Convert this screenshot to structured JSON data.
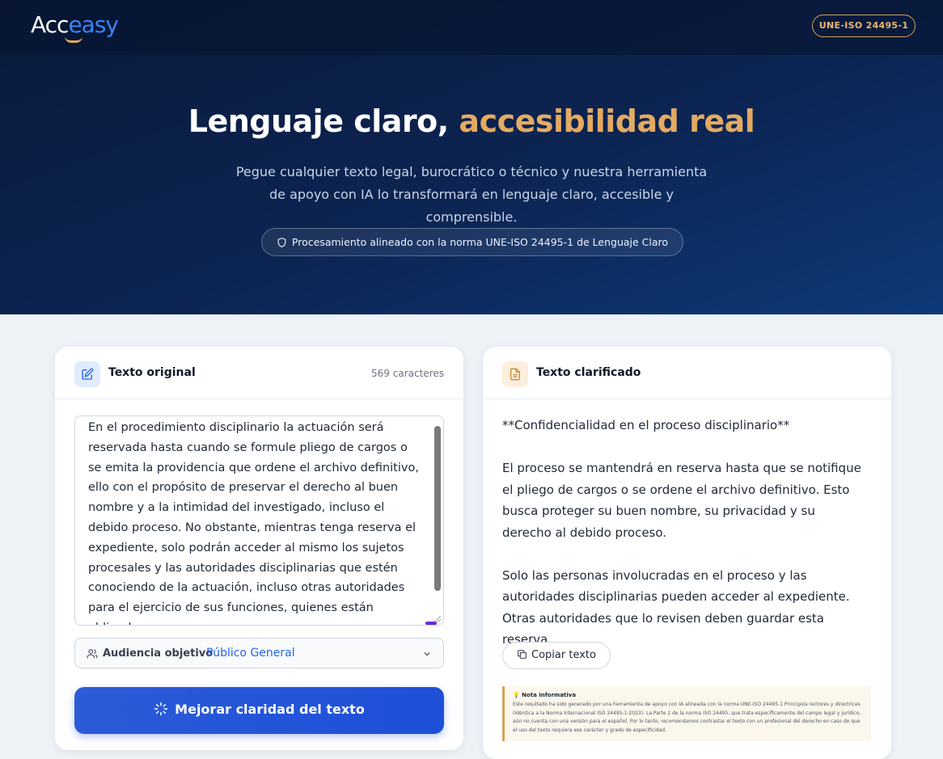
{
  "header": {
    "logo_part1": "Acc",
    "logo_part2": "easy",
    "iso_badge": "UNE-ISO 24495-1"
  },
  "hero": {
    "title_plain": "Lenguaje claro,",
    "title_accent": "accesibilidad real",
    "subtitle": "Pegue cualquier texto legal, burocrático o técnico y nuestra herramienta de apoyo con IA lo transformará en lenguaje claro, accesible y comprensible.",
    "pill": "Procesamiento alineado con la norma UNE-ISO 24495-1 de Lenguaje Claro"
  },
  "original": {
    "title": "Texto original",
    "char_count": "569 caracteres",
    "text": "En el procedimiento disciplinario la actuación será reservada hasta cuando se formule pliego de cargos o se emita la providencia que ordene el archivo definitivo, ello con el propósito de preservar el derecho al buen nombre y a la intimidad del investigado, incluso el debido proceso. No obstante, mientras tenga reserva el expediente, solo podrán acceder al mismo los sujetos procesales y las autoridades disciplinarias que estén conociendo de la actuación, incluso otras autoridades para el ejercicio de sus funciones, quienes están obligados a preservar esa",
    "audience_label": "Audiencia objetivo",
    "audience_value": "Público General",
    "improve_button": "Mejorar claridad del texto"
  },
  "clarified": {
    "title": "Texto clarificado",
    "paragraph1": "**Confidencialidad en el proceso disciplinario**",
    "paragraph2": "El proceso se mantendrá en reserva hasta que se notifique el pliego de cargos o se ordene el archivo definitivo. Esto busca proteger su buen nombre, su privacidad y su derecho al debido proceso.",
    "paragraph3": "Solo las personas involucradas en el proceso y las autoridades disciplinarias pueden acceder al expediente. Otras autoridades que lo revisen deben guardar esta reserva.",
    "copy_button": "Copiar texto",
    "note_title": "Nota informativa",
    "note_body": "Este resultado ha sido generado por una herramienta de apoyo con IA alineada con la norma UNE-ISO 24495-1 Principios rectores y directrices (Idéntica a la Norma Internacional ISO 24495-1:2023). La Parte 2 de la norma ISO 24495, que trata específicamente del campo legal y jurídico, aún no cuenta con una versión para el español. Por lo tanto, recomendamos contrastar el texto con un profesional del derecho en caso de que el uso del texto requiera ese carácter y grado de especificidad."
  },
  "colors": {
    "hero_dark": "#0a1a3a",
    "accent_gold": "#e3aa62",
    "primary_blue": "#1d4fd8"
  }
}
